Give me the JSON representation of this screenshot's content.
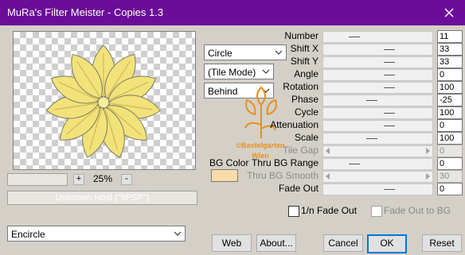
{
  "window": {
    "title": "MuRa's Filter Meister - Copies 1.3"
  },
  "preview": {
    "zoom_label": "25%",
    "zoom_plus": "+",
    "zoom_minus": "-",
    "status_text": "Unknown Host (\"9PSP\")"
  },
  "combos": {
    "shape": "Circle",
    "mode": "(Tile Mode)",
    "order": "Behind",
    "effect": "Encircle"
  },
  "bg_color": {
    "label": "BG Color",
    "swatch": "#f9dca7"
  },
  "watermark": {
    "line1": "©Bastelgarten",
    "line2": "Wien"
  },
  "parameters": [
    {
      "label": "Number",
      "value": "11",
      "level": 0.2,
      "enabled": true
    },
    {
      "label": "Shift X",
      "value": "33",
      "level": 0.6,
      "enabled": true
    },
    {
      "label": "Shift Y",
      "value": "33",
      "level": 0.6,
      "enabled": true
    },
    {
      "label": "Angle",
      "value": "0",
      "level": 0.6,
      "enabled": true
    },
    {
      "label": "Rotation",
      "value": "100",
      "level": 0.6,
      "enabled": true
    },
    {
      "label": "Phase",
      "value": "-25",
      "level": 0.4,
      "enabled": true
    },
    {
      "label": "Cycle",
      "value": "100",
      "level": 0.6,
      "enabled": true
    },
    {
      "label": "Attenuation",
      "value": "0",
      "level": 0.6,
      "enabled": true
    },
    {
      "label": "Scale",
      "value": "100",
      "level": 0.4,
      "enabled": true
    },
    {
      "label": "Tile Gap",
      "value": "0",
      "level": 0,
      "enabled": false
    },
    {
      "label": "Thru BG Range",
      "value": "0",
      "level": 0.2,
      "enabled": true
    },
    {
      "label": "Thru BG Smooth",
      "value": "30",
      "level": 0,
      "enabled": false
    },
    {
      "label": "Fade Out",
      "value": "0",
      "level": 0.6,
      "enabled": true
    }
  ],
  "checkboxes": {
    "fade_1n": "1/n Fade Out",
    "fade_bg": "Fade Out to BG"
  },
  "buttons": {
    "web": "Web",
    "about": "About...",
    "cancel": "Cancel",
    "ok": "OK",
    "reset": "Reset"
  },
  "colors": {
    "title_bar": "#6a0d99",
    "dialog_bg": "#d4d0c8",
    "flower_fill": "#f2e27a",
    "flower_stroke": "#7a7a60",
    "watermark": "#e8901a"
  }
}
